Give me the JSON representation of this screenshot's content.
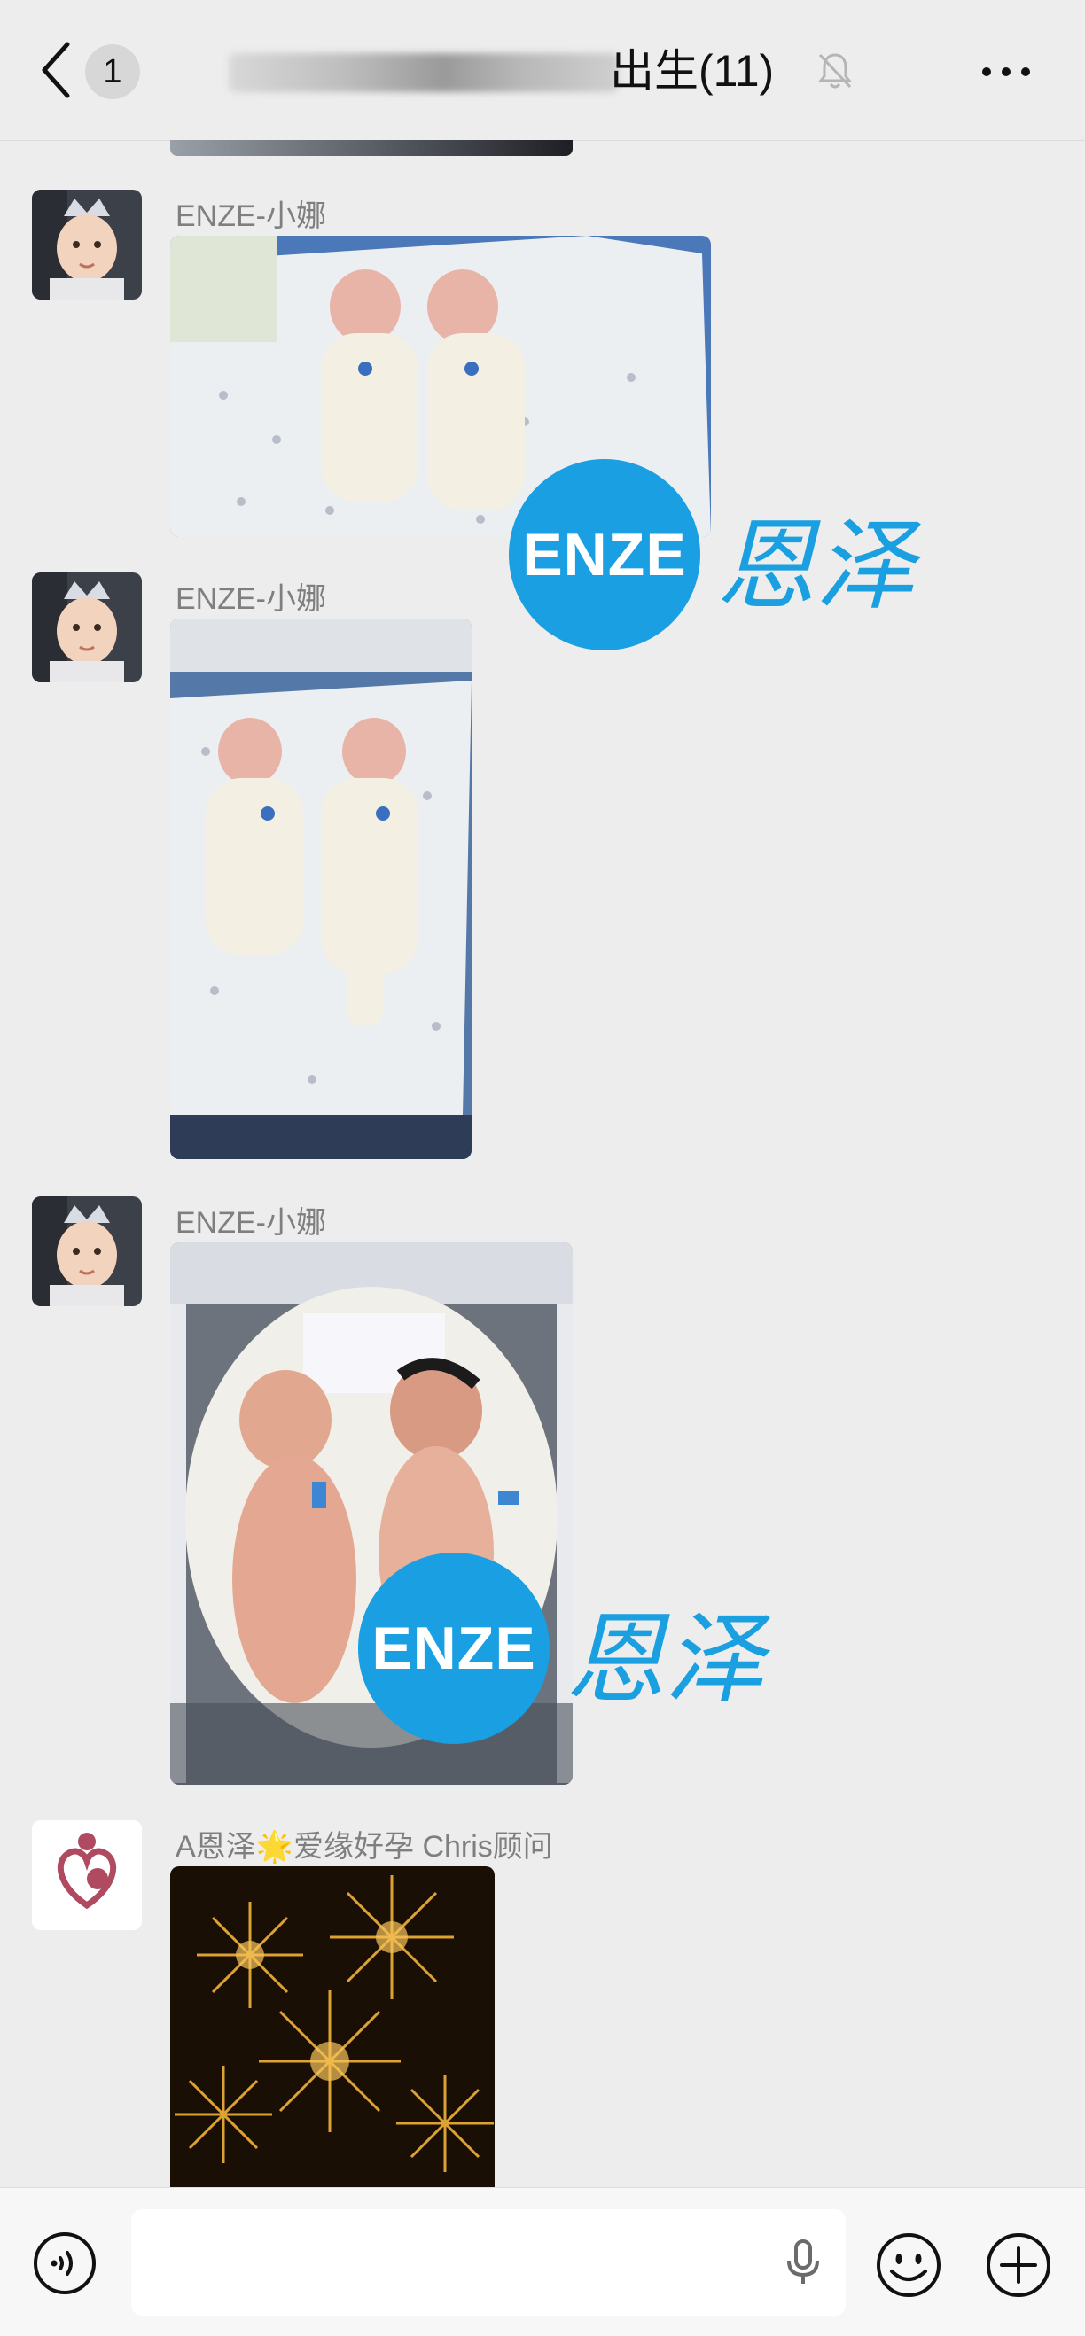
{
  "header": {
    "unread_count": "1",
    "title": "出生(11)"
  },
  "messages": [
    {
      "sender": "ENZE-小娜"
    },
    {
      "sender": "ENZE-小娜"
    },
    {
      "sender": "ENZE-小娜"
    },
    {
      "sender": "A恩泽🌟爱缘好孕 Chris顾问"
    }
  ],
  "watermark": {
    "logo_text": "ENZE",
    "brand_text": "恩泽",
    "color": "#1a9fe3"
  },
  "input_bar": {
    "placeholder": ""
  },
  "icons": {
    "back": "back-arrow-icon",
    "mute": "muted-bell-icon",
    "more": "more-dots-icon",
    "voice": "voice-input-icon",
    "mic": "microphone-icon",
    "emoji": "emoji-icon",
    "plus": "plus-icon"
  }
}
